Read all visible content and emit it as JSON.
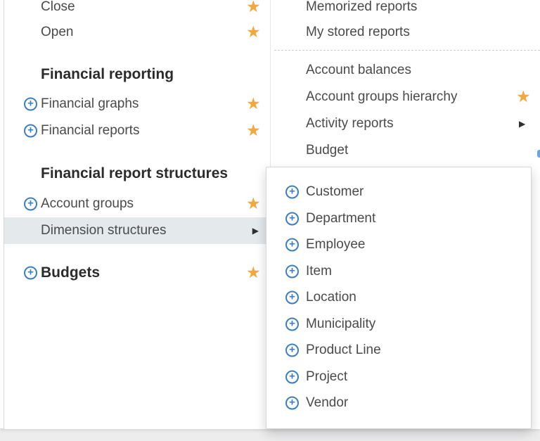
{
  "icons": {
    "star": "★",
    "plus": "+",
    "submenu_arrow": "▶"
  },
  "colors": {
    "favorite_star": "#f1a83c",
    "plus_icon_blue": "#3c7ebf",
    "highlighted_row_bg": "#e4e9ec",
    "item_text": "#4a4a4a",
    "header_text": "#2b2b2b",
    "page_background": "#ededee"
  },
  "left_panel": {
    "items": [
      {
        "label": "Close",
        "favorited": true
      },
      {
        "label": "Open",
        "favorited": true
      }
    ],
    "sections": [
      {
        "title": "Financial reporting",
        "items": [
          {
            "label": "Financial graphs",
            "favorited": true
          },
          {
            "label": "Financial reports",
            "favorited": true
          }
        ]
      },
      {
        "title": "Financial report structures",
        "items": [
          {
            "label": "Account groups",
            "favorited": true
          },
          {
            "label": "Dimension structures",
            "highlighted": true,
            "has_submenu": true
          }
        ]
      }
    ],
    "budgets": {
      "label": "Budgets",
      "favorited": true
    }
  },
  "right_panel": {
    "items_top": [
      {
        "label": "Memorized reports"
      },
      {
        "label": "My stored reports"
      }
    ],
    "items_bottom": [
      {
        "label": "Account balances"
      },
      {
        "label": "Account groups hierarchy",
        "favorited": true
      },
      {
        "label": "Activity reports",
        "has_submenu": true
      },
      {
        "label": "Budget"
      }
    ]
  },
  "flyout": {
    "items": [
      {
        "label": "Customer"
      },
      {
        "label": "Department"
      },
      {
        "label": "Employee"
      },
      {
        "label": "Item"
      },
      {
        "label": "Location"
      },
      {
        "label": "Municipality"
      },
      {
        "label": "Product Line"
      },
      {
        "label": "Project"
      },
      {
        "label": "Vendor"
      }
    ]
  }
}
